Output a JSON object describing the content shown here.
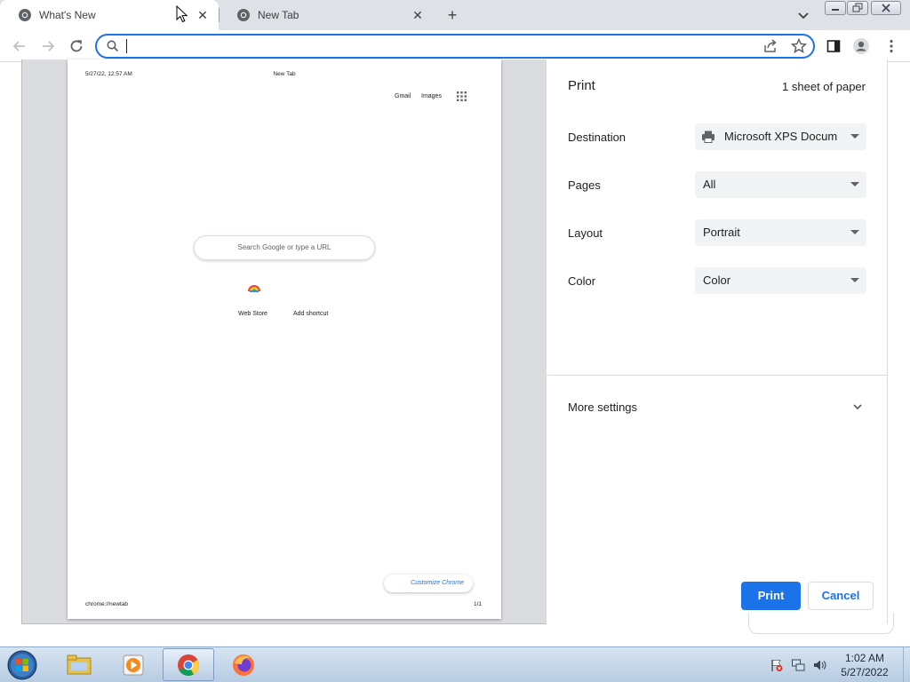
{
  "browser": {
    "tabs": [
      {
        "title": "What's New",
        "active": true
      },
      {
        "title": "New Tab",
        "active": false
      }
    ],
    "new_tab_symbol": "+",
    "close_symbol": "✕",
    "omnibox": {
      "value": "",
      "placeholder": ""
    }
  },
  "preview": {
    "header_date": "5/27/22, 12:57 AM",
    "header_title": "New Tab",
    "gmail": "Gmail",
    "images": "Images",
    "search_placeholder": "Search Google or type a URL",
    "shortcuts": [
      "Web Store",
      "Add shortcut"
    ],
    "customize": "Customize Chrome",
    "footer_url": "chrome://newtab",
    "footer_page": "1/1"
  },
  "print_dialog": {
    "title": "Print",
    "sheet_count": "1 sheet of paper",
    "rows": [
      {
        "label": "Destination",
        "value": "Microsoft XPS Docum"
      },
      {
        "label": "Pages",
        "value": "All"
      },
      {
        "label": "Layout",
        "value": "Portrait"
      },
      {
        "label": "Color",
        "value": "Color"
      }
    ],
    "more_settings": "More settings",
    "print_button": "Print",
    "cancel_button": "Cancel"
  },
  "taskbar": {
    "time": "1:02 AM",
    "date": "5/27/2022",
    "apps": [
      "file-explorer-icon",
      "media-player-icon",
      "chrome-icon",
      "firefox-icon"
    ],
    "active_app": "chrome-icon"
  },
  "colors": {
    "accent": "#1a73e8",
    "tabstrip": "#dee1e6",
    "preview_bg": "#dadce0",
    "select_bg": "#f1f3f4"
  }
}
